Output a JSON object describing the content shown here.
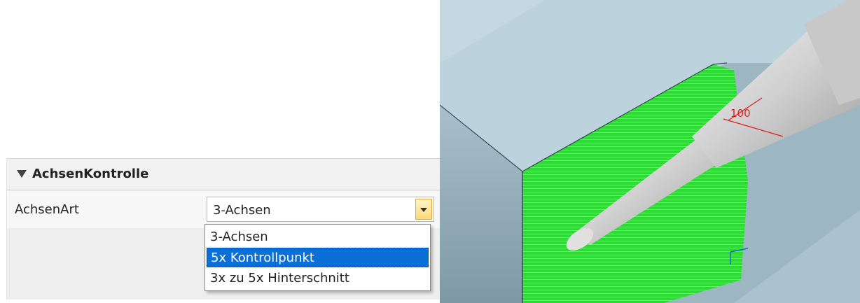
{
  "property_grid": {
    "category": {
      "icon": "collapse-triangle-icon",
      "title": "AchsenKontrolle"
    },
    "row": {
      "label": "AchsenArt",
      "selected_value": "3-Achsen"
    },
    "dropdown": {
      "button_icon": "chevron-down-icon",
      "options": [
        "3-Achsen",
        "5x Kontrollpunkt",
        "3x zu 5x Hinterschnitt"
      ],
      "highlighted_option": "5x Kontrollpunkt"
    }
  },
  "viewport": {
    "annotation_label": "100",
    "colors": {
      "part_top": "#b9d2dc",
      "part_side": "#8fa9b6",
      "toolpath": "#33e03a",
      "tool": "#d0d0d0",
      "annotation": "#dd2020",
      "axis": "#2a5fd8"
    }
  }
}
